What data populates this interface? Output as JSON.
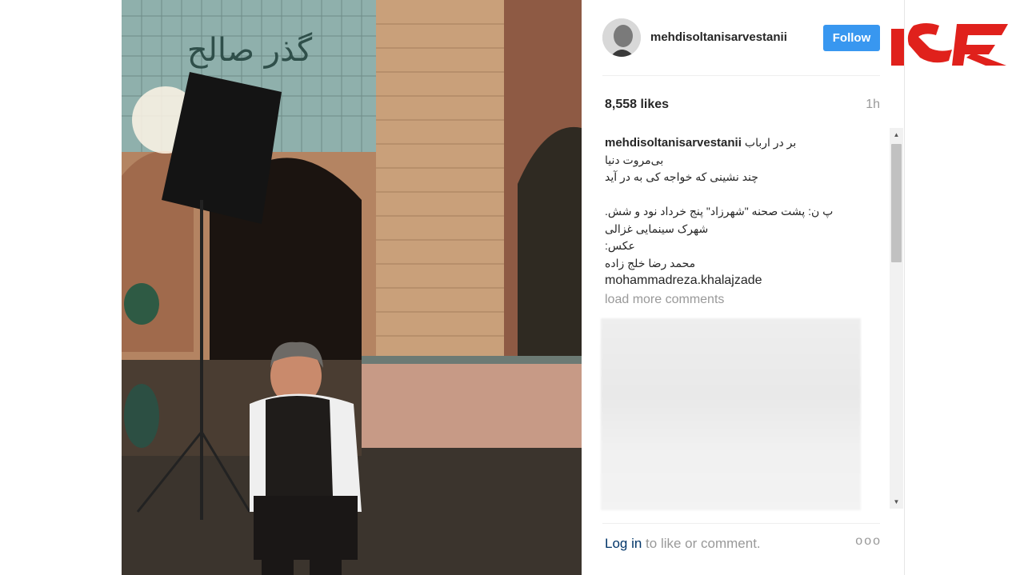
{
  "post": {
    "username": "mehdisoltanisarvestanii",
    "follow_label": "Follow",
    "likes": "8,558 likes",
    "time": "1h",
    "caption_user": "mehdisoltanisarvestanii",
    "caption_lines": [
      "بر در ارباب",
      "بی‌مروت دنیا",
      "چند نشینی که خواجه کی به در آید",
      "",
      "پ ن: پشت صحنه \"شهرزاد\" پنج خرداد نود و شش.",
      "شهرک سینمایی غزالی",
      "عکس:",
      "محمد رضا خلج زاده",
      "mohammadreza.khalajzade"
    ],
    "load_more": "load more comments",
    "login_link": "Log in",
    "login_rest": " to like or comment.",
    "more_options": "ooo"
  },
  "photo": {
    "sign_text": "گذر صالح"
  },
  "colors": {
    "follow_blue": "#3897f0",
    "logo_red": "#e0211c"
  }
}
